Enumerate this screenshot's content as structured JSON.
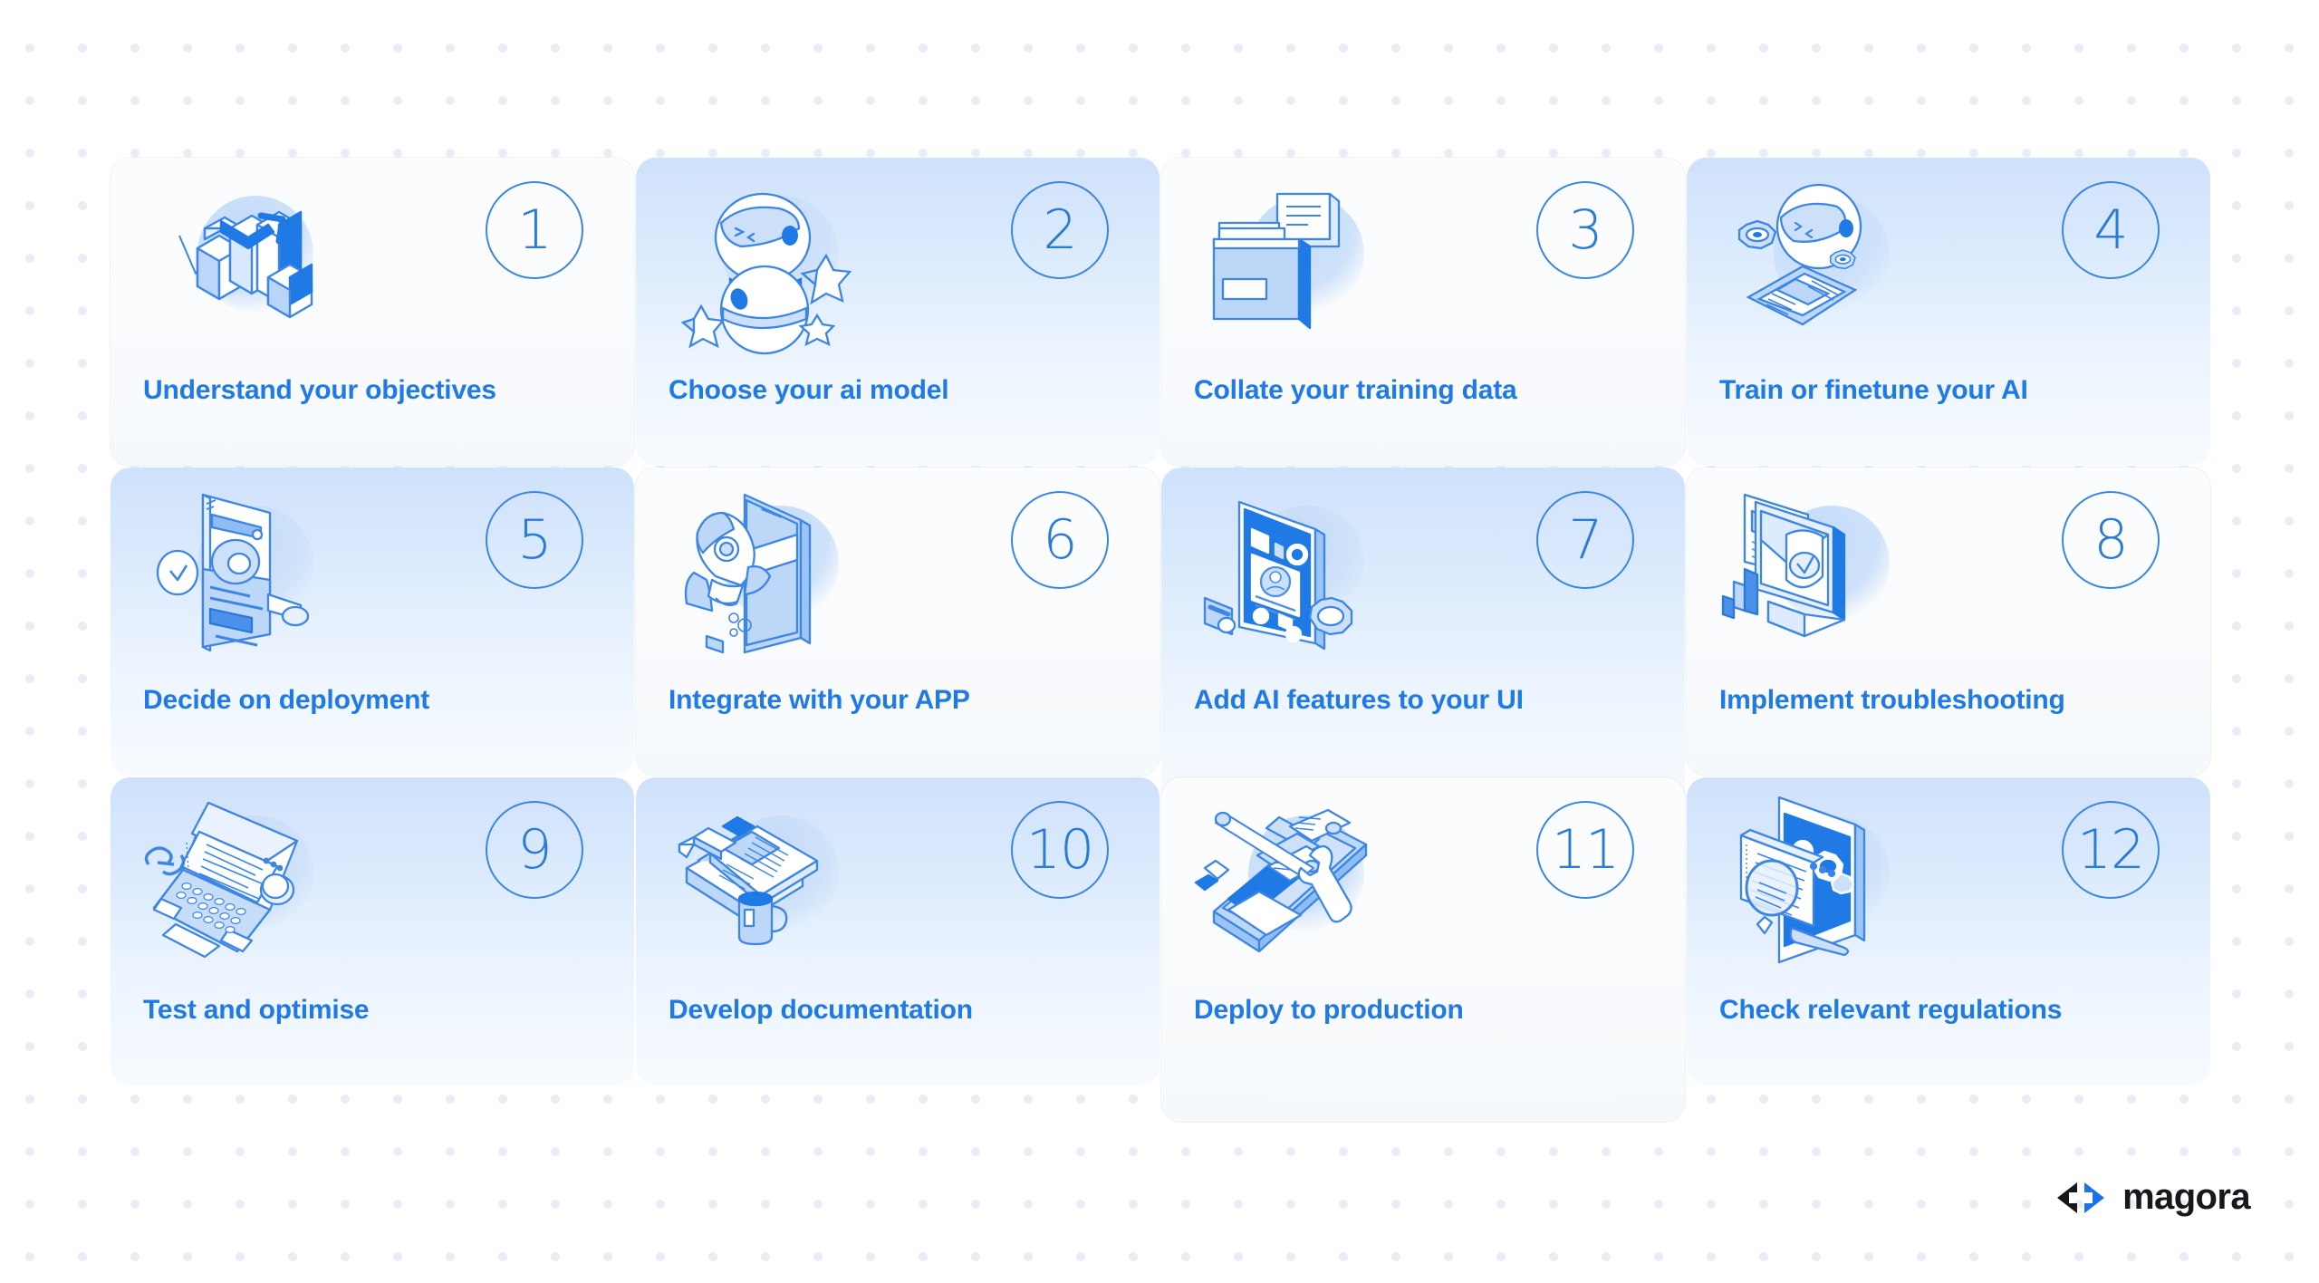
{
  "theme": {
    "accent_blue": "#1f7ae6",
    "number_blue": "#2a7ad8",
    "tint_top": "#cfe1fb",
    "dot_color": "#e9edf5",
    "logo_black": "#17181c",
    "logo_blue": "#1a73e8"
  },
  "cards": [
    {
      "number": "1",
      "title": "Understand your objectives",
      "icon": "bar-chart-growth-icon",
      "style": "plain"
    },
    {
      "number": "2",
      "title": "Choose your ai model",
      "icon": "robot-icon",
      "style": "tinted"
    },
    {
      "number": "3",
      "title": "Collate your training data",
      "icon": "folder-chat-icon",
      "style": "plain"
    },
    {
      "number": "4",
      "title": "Train or finetune your AI",
      "icon": "robot-head-gears-icon",
      "style": "tinted"
    },
    {
      "number": "5",
      "title": "Decide on deployment",
      "icon": "mobile-clock-icon",
      "style": "tinted"
    },
    {
      "number": "6",
      "title": "Integrate with your APP",
      "icon": "rocket-phone-icon",
      "style": "plain"
    },
    {
      "number": "7",
      "title": "Add AI features to your UI",
      "icon": "phone-ui-gear-icon",
      "style": "tinted"
    },
    {
      "number": "8",
      "title": "Implement troubleshooting",
      "icon": "monitor-shield-icon",
      "style": "plain"
    },
    {
      "number": "9",
      "title": "Test and optimise",
      "icon": "laptop-code-icon",
      "style": "tinted"
    },
    {
      "number": "10",
      "title": "Develop documentation",
      "icon": "book-pen-mug-icon",
      "style": "tinted"
    },
    {
      "number": "11",
      "title": "Deploy to production",
      "icon": "phone-tools-icon",
      "style": "plain"
    },
    {
      "number": "12",
      "title": "Check relevant regulations",
      "icon": "document-magnifier-icon",
      "style": "tinted"
    }
  ],
  "brand": {
    "name": "magora",
    "mark": "code-arrows-logo"
  }
}
